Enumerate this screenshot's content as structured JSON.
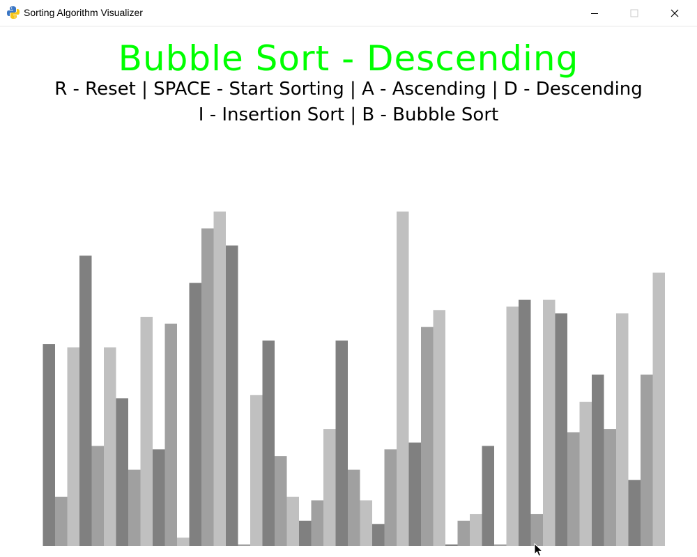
{
  "window": {
    "title": "Sorting Algorithm Visualizer",
    "icons": {
      "app": "python-snake-icon",
      "minimize": "minimize-icon",
      "maximize": "maximize-icon",
      "close": "close-icon"
    }
  },
  "heading": "Bubble Sort - Descending",
  "help": {
    "line1": "R - Reset | SPACE - Start Sorting | A - Ascending | D - Descending",
    "line2": "I - Insertion Sort | B - Bubble Sort"
  },
  "colors": {
    "heading": "#00ff00",
    "text": "#000000",
    "background": "#ffffff",
    "bar_shades": [
      "#808080",
      "#a0a0a0",
      "#c0c0c0"
    ]
  },
  "chart_data": {
    "type": "bar",
    "title": "",
    "xlabel": "",
    "ylabel": "",
    "ylim": [
      0,
      100
    ],
    "values": [
      59,
      14,
      58,
      85,
      29,
      58,
      43,
      22,
      67,
      28,
      65,
      2,
      77,
      93,
      98,
      88,
      0,
      44,
      60,
      26,
      14,
      7,
      13,
      34,
      60,
      22,
      13,
      6,
      28,
      98,
      30,
      64,
      69,
      0,
      7,
      9,
      29,
      0,
      70,
      72,
      9,
      72,
      68,
      33,
      42,
      50,
      34,
      68,
      19,
      50,
      80
    ]
  }
}
